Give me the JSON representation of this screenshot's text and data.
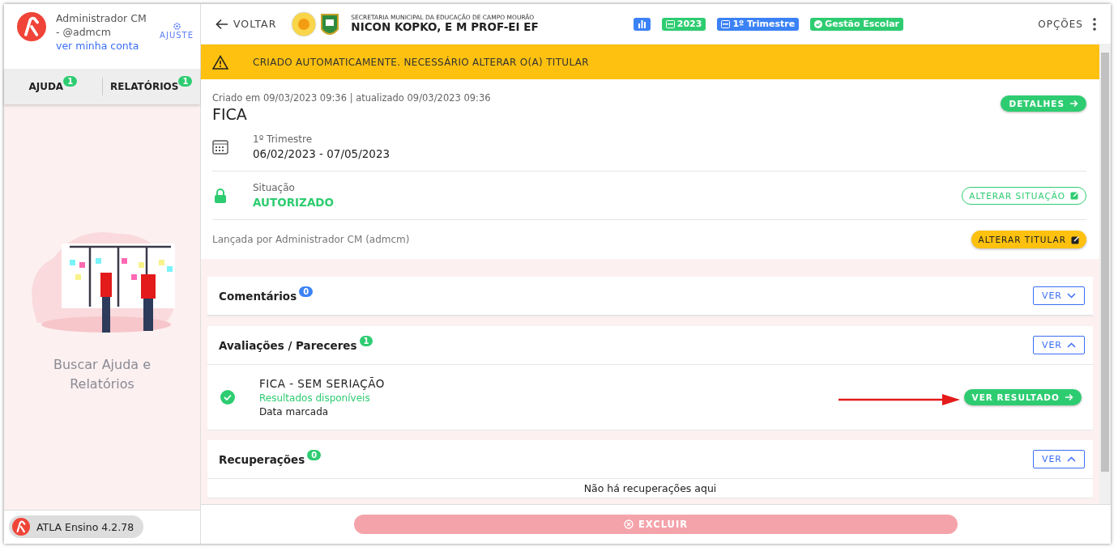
{
  "sidebar": {
    "user_name": "Administrador CM",
    "user_handle": "- @admcm",
    "account_link": "ver minha conta",
    "settings_label": "AJUSTE",
    "tabs": [
      {
        "label": "AJUDA",
        "count": "1",
        "selected": false
      },
      {
        "label": "RELATÓRIOS",
        "count": "1",
        "selected": false
      }
    ],
    "empty_text": "Buscar Ajuda e Relatórios",
    "version": "ATLA Ensino 4.2.78"
  },
  "header": {
    "back_label": "VOLTAR",
    "org_name": "SECRETARIA MUNICIPAL DA EDUCAÇÃO DE CAMPO MOURÃO",
    "school_name": "NICON KOPKO, E M PROF-EI EF",
    "chips": [
      {
        "kind": "icon",
        "color": "#3b82f6"
      },
      {
        "kind": "calendar",
        "label": "2023",
        "color": "#2ecc71"
      },
      {
        "kind": "calendar",
        "label": "1º Trimestre",
        "color": "#3b82f6"
      },
      {
        "kind": "check",
        "label": "Gestão Escolar",
        "color": "#2ecc71"
      }
    ],
    "options_label": "OPÇÕES"
  },
  "banner": "CRIADO AUTOMATICAMENTE. NECESSÁRIO ALTERAR O(A) TITULAR",
  "record": {
    "meta": "Criado em 09/03/2023 09:36 | atualizado 09/03/2023 09:36",
    "title": "FICA",
    "details_button": "DETALHES",
    "period_label": "1º Trimestre",
    "period_dates": "06/02/2023 - 07/05/2023",
    "status_label": "Situação",
    "status_value": "AUTORIZADO",
    "status_button": "ALTERAR SITUAÇÃO",
    "owner_text": "Lançada por Administrador CM (admcm)",
    "owner_button": "ALTERAR TITULAR"
  },
  "sections": [
    {
      "title": "Comentários",
      "count": "0",
      "color": "#3b82f6",
      "button": "VER",
      "expanded": false
    },
    {
      "title": "Avaliações / Pareceres",
      "count": "1",
      "color": "#2ecc71",
      "button": "VER",
      "expanded": true,
      "items": [
        {
          "title": "FICA - SEM SERIAÇÃO",
          "status": "Resultados disponíveis",
          "note": "Data marcada",
          "button": "VER RESULTADO"
        }
      ]
    },
    {
      "title": "Recuperações",
      "count": "0",
      "color": "#2ecc71",
      "button": "VER",
      "expanded": true,
      "empty_text": "Não há recuperações aqui"
    }
  ],
  "delete_button": "EXCLUIR"
}
